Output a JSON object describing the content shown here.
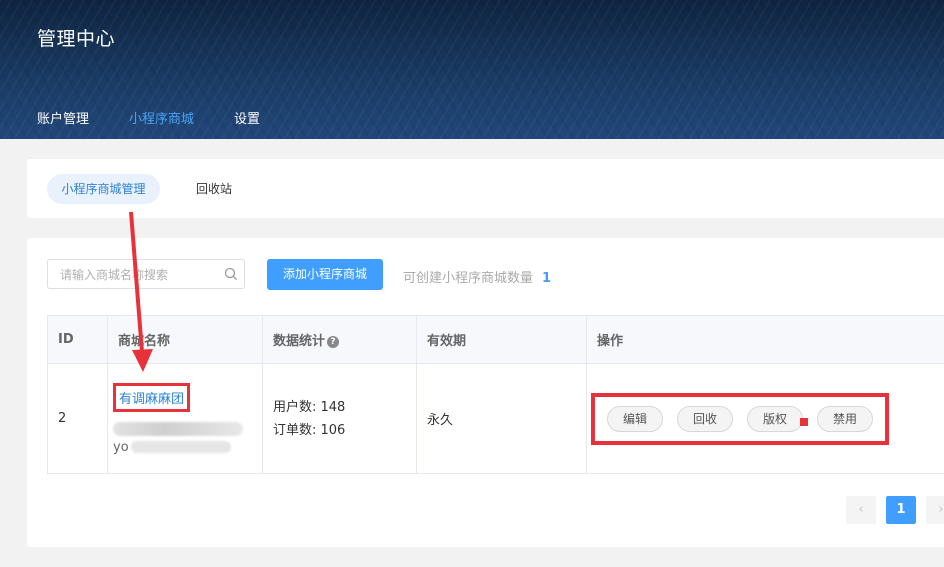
{
  "header": {
    "title": "管理中心",
    "nav": [
      {
        "label": "账户管理"
      },
      {
        "label": "小程序商城"
      },
      {
        "label": "设置"
      }
    ]
  },
  "subtabs": [
    {
      "label": "小程序商城管理"
    },
    {
      "label": "回收站"
    }
  ],
  "toolbar": {
    "search_placeholder": "请输入商城名称搜索",
    "add_label": "添加小程序商城",
    "quota_label": "可创建小程序商城数量",
    "quota_value": "1"
  },
  "table": {
    "columns": [
      "ID",
      "商城名称",
      "数据统计",
      "有效期",
      "操作"
    ],
    "rows": [
      {
        "id": "2",
        "name": "有调麻麻团",
        "owner_prefix": "yo",
        "users": "用户数: 148",
        "orders": "订单数: 106",
        "validity": "永久",
        "actions": [
          "编辑",
          "回收",
          "版权",
          "禁用"
        ]
      }
    ]
  },
  "pager": {
    "prev": "‹",
    "current": "1",
    "next": "›"
  },
  "colors": {
    "accent": "#409eff",
    "annotation": "#e8323b",
    "header_bg": "#1a3c66"
  }
}
